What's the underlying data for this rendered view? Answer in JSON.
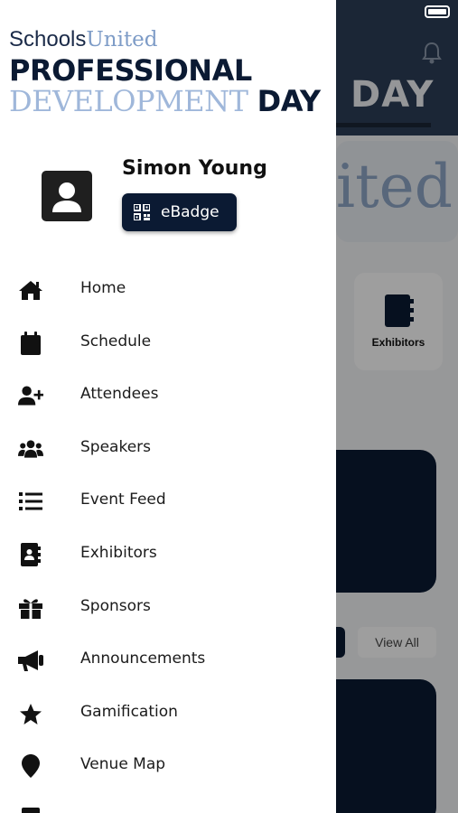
{
  "logo": {
    "schools": "Schools",
    "united": "United",
    "line2": "PROFESSIONAL",
    "line3_a": "DEVELOPMENT",
    "line3_b": "DAY"
  },
  "profile": {
    "name": "Simon Young",
    "badge_label": "eBadge",
    "avatar_icon": "user-silhouette-icon",
    "badge_icon": "qr-code-icon"
  },
  "menu": {
    "items": [
      {
        "label": "Home",
        "icon": "home-icon"
      },
      {
        "label": "Schedule",
        "icon": "calendar-icon"
      },
      {
        "label": "Attendees",
        "icon": "user-plus-icon"
      },
      {
        "label": "Speakers",
        "icon": "users-icon"
      },
      {
        "label": "Event Feed",
        "icon": "list-icon"
      },
      {
        "label": "Exhibitors",
        "icon": "address-book-icon"
      },
      {
        "label": "Sponsors",
        "icon": "gift-icon"
      },
      {
        "label": "Announcements",
        "icon": "megaphone-icon"
      },
      {
        "label": "Gamification",
        "icon": "star-icon"
      },
      {
        "label": "Venue Map",
        "icon": "map-pin-icon"
      }
    ]
  },
  "background": {
    "header_text": "DAY",
    "banner_text": "ited",
    "tile_label": "Exhibitors",
    "view_all_label": "View All"
  },
  "colors": {
    "primary": "#0b1a33",
    "logo_light": "#9fb7da",
    "overlay": "rgba(0,0,0,0.38)"
  }
}
